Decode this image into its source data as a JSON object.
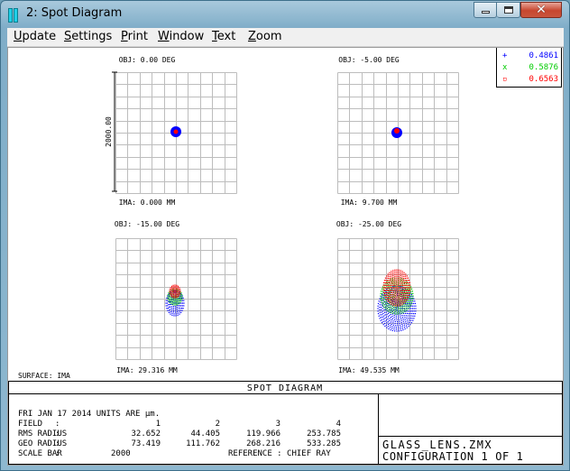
{
  "window": {
    "title": "2: Spot Diagram"
  },
  "menu": {
    "items": [
      {
        "label": "Update"
      },
      {
        "label": "Settings"
      },
      {
        "label": "Print"
      },
      {
        "label": "Window"
      },
      {
        "label": "Text"
      },
      {
        "label": "Zoom"
      }
    ]
  },
  "legend": [
    {
      "marker": "+",
      "value": "0.4861",
      "color": "#0000ff"
    },
    {
      "marker": "x",
      "value": "0.5876",
      "color": "#00cc00"
    },
    {
      "marker": "▫",
      "value": "0.6563",
      "color": "#ff0000"
    }
  ],
  "colors": {
    "blue": "#0000ff",
    "green": "#00c000",
    "red": "#ff0000"
  },
  "spots": [
    {
      "obj": "OBJ: 0.00 DEG",
      "ima": "IMA: 0.000 MM"
    },
    {
      "obj": "OBJ: -5.00 DEG",
      "ima": "IMA: 9.700 MM"
    },
    {
      "obj": "OBJ: -15.00 DEG",
      "ima": "IMA: 29.316 MM"
    },
    {
      "obj": "OBJ: -25.00 DEG",
      "ima": "IMA: 49.535 MM"
    }
  ],
  "scale_label": "2000.00",
  "surface": "SURFACE: IMA",
  "panel_title": "SPOT DIAGRAM",
  "info": {
    "date_units": "FRI JAN 17 2014  UNITS ARE µm.",
    "field_label": "FIELD",
    "field_values": [
      "1",
      "2",
      "3",
      "4"
    ],
    "rms_label": "RMS RADIUS",
    "rms_values": [
      "32.652",
      "44.405",
      "119.966",
      "253.785"
    ],
    "geo_label": "GEO RADIUS",
    "geo_values": [
      "73.419",
      "111.762",
      "268.216",
      "533.285"
    ],
    "scale_bar_label": "SCALE BAR",
    "scale_bar_value": "2000",
    "reference": "REFERENCE  : CHIEF RAY",
    "colon": ":"
  },
  "file": {
    "name": "GLASS_LENS.ZMX",
    "configuration": "CONFIGURATION 1 OF 1"
  }
}
